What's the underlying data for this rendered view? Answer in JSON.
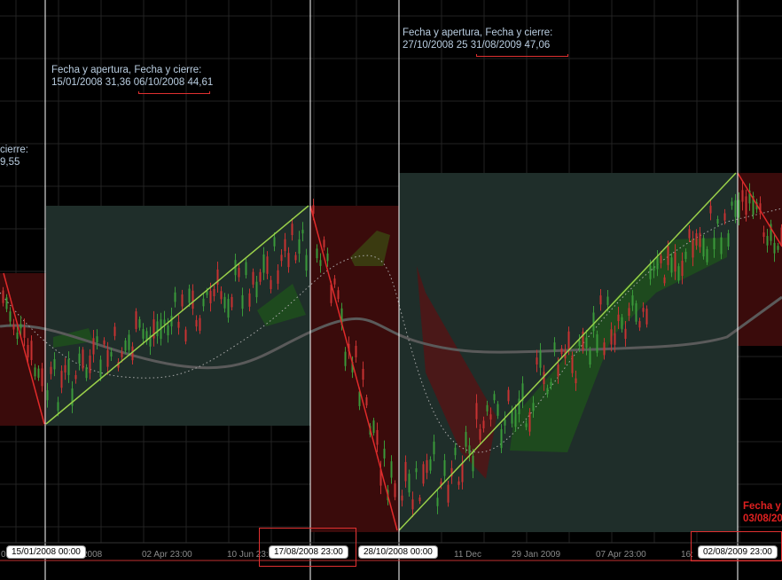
{
  "colors": {
    "background": "#000000",
    "grid": "#222222",
    "bull_candle": "#3a9a3a",
    "bear_candle": "#c83232",
    "up_trend": "#9ad04a",
    "down_trend": "#e02a2a",
    "up_zone": "#1f2e2a",
    "down_zone": "#3a0b0b",
    "cloud_bull": "#1e4a1e",
    "cloud_bear": "#4a1818",
    "moving_average": "#5a5a5a",
    "info_text": "#b9cde0",
    "marker_line": "#ffffff"
  },
  "annotations": [
    {
      "line1": "Fecha y apertura,      Fecha y cierre:",
      "line2": "15/01/2008 31,36 06/10/2008 44,61"
    },
    {
      "line1": "Fecha y apertura,      Fecha y cierre:",
      "line2": "27/10/2008 25 31/08/2009 47,06"
    },
    {
      "line1": "cierre:",
      "line2": "9,55"
    },
    {
      "line1": "Fecha y",
      "line2": "03/08/20"
    }
  ],
  "x_axis": {
    "ticks": [
      "2008",
      "02 Apr 23:00",
      "10 Jun 23:",
      "11 Dec",
      "29 Jan 2009",
      "07 Apr 23:00",
      "16:"
    ],
    "badges": [
      "15/01/2008 00:00",
      "17/08/2008 23:00",
      "28/10/2008 00:00",
      "02/08/2009 23:00"
    ],
    "left_fragment": "0"
  },
  "chart_data": {
    "type": "candlestick",
    "period": {
      "start": "2008-01",
      "end": "2009-08"
    },
    "trends": [
      {
        "direction": "down",
        "from": "before 15/01/2008",
        "to": "15/01/2008"
      },
      {
        "direction": "up",
        "open_date": "15/01/2008",
        "open": 31.36,
        "close_date": "06/10/2008",
        "close": 44.61
      },
      {
        "direction": "down",
        "from": "06/10/2008",
        "to": "27/10/2008"
      },
      {
        "direction": "up",
        "open_date": "27/10/2008",
        "open": 25,
        "close_date": "31/08/2009",
        "close": 47.06
      },
      {
        "direction": "down",
        "from": "31/08/2009",
        "to": "after 31/08/2009"
      }
    ],
    "markers": [
      "15/01/2008 00:00",
      "28/10/2008 00:00",
      "02/08/2009 23:00"
    ],
    "overlays": [
      "ichimoku cloud",
      "moving average",
      "dotted average"
    ],
    "grid": true
  }
}
